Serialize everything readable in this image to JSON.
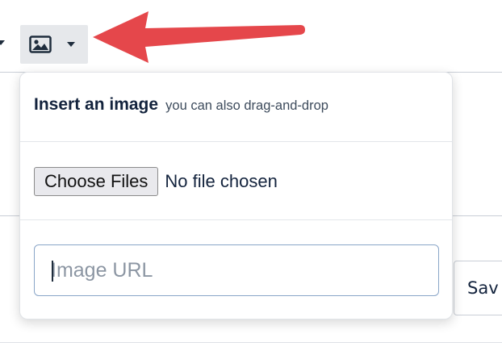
{
  "toolbar": {
    "image_button_icon": "image-icon",
    "dropdown_icon": "chevron-down-icon"
  },
  "popup": {
    "title": "Insert an image",
    "subtitle": "you can also drag-and-drop",
    "choose_files_label": "Choose Files",
    "no_file_text": "No file chosen",
    "url_placeholder": "Image URL",
    "url_value": ""
  },
  "side": {
    "save_label": "Sav"
  },
  "colors": {
    "arrow": "#e5474b",
    "title_text": "#13233d",
    "input_border": "#8aa6c8"
  }
}
